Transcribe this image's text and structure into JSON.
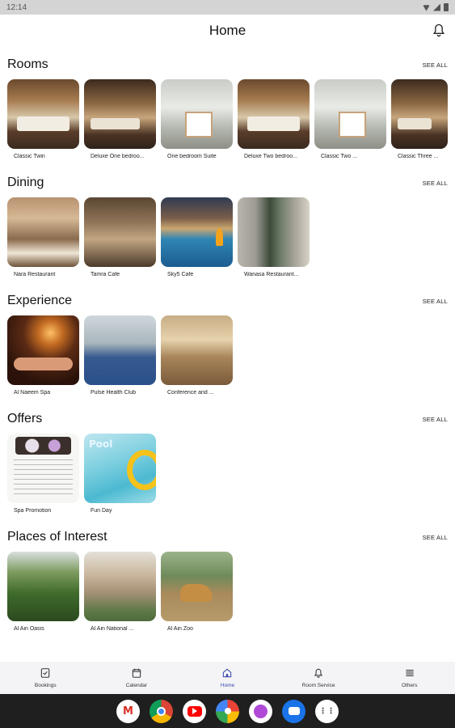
{
  "status_bar": {
    "time": "12:14"
  },
  "header": {
    "title": "Home"
  },
  "sections": [
    {
      "title": "Rooms",
      "see_all": "SEE ALL",
      "items": [
        {
          "label": "Classic Twin"
        },
        {
          "label": "Deluxe One bedroo..."
        },
        {
          "label": "One bedroom Suite"
        },
        {
          "label": "Deluxe Two bedroo..."
        },
        {
          "label": "Classic Two ..."
        },
        {
          "label": "Classic Three ..."
        }
      ]
    },
    {
      "title": "Dining",
      "see_all": "SEE ALL",
      "items": [
        {
          "label": "Nara Restaurant"
        },
        {
          "label": "Tamra Cafe"
        },
        {
          "label": "Sky5 Cafe"
        },
        {
          "label": "Wanasa Restaurant..."
        }
      ]
    },
    {
      "title": "Experience",
      "see_all": "SEE ALL",
      "items": [
        {
          "label": "Al Naeem Spa"
        },
        {
          "label": "Pulse Health Club"
        },
        {
          "label": "Conference and ..."
        }
      ]
    },
    {
      "title": "Offers",
      "see_all": "SEE ALL",
      "items": [
        {
          "label": "Spa Promotion"
        },
        {
          "label": "Fun Day"
        }
      ],
      "pool_word": "Pool"
    },
    {
      "title": "Places of Interest",
      "see_all": "SEE ALL",
      "items": [
        {
          "label": "Al Ain Oasis"
        },
        {
          "label": "Al Ain National ..."
        },
        {
          "label": "Al Ain Zoo"
        }
      ]
    }
  ],
  "bottom_nav": [
    {
      "label": "Bookings",
      "icon": "bookings-icon"
    },
    {
      "label": "Calendar",
      "icon": "calendar-icon"
    },
    {
      "label": "Home",
      "icon": "home-icon",
      "active": true
    },
    {
      "label": "Room Service",
      "icon": "room-service-icon"
    },
    {
      "label": "Others",
      "icon": "others-icon"
    }
  ],
  "colors": {
    "accent": "#3949ab",
    "nav_bg": "#f4f4f6",
    "dock_bg": "#1f1f1f"
  },
  "dock_apps": [
    "gmail-icon",
    "chrome-icon",
    "youtube-icon",
    "photos-icon",
    "podcast-icon",
    "messages-icon",
    "app-drawer-icon"
  ]
}
